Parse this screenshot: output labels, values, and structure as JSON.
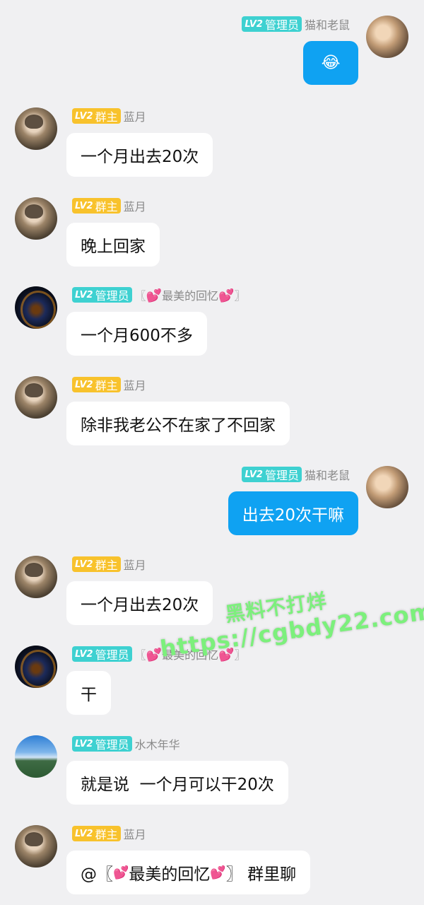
{
  "messages": [
    {
      "side": "out",
      "role": "管理员",
      "name": "猫和老鼠",
      "content": "😂",
      "avatar": "cat-avatar"
    },
    {
      "side": "in",
      "role": "群主",
      "name": "蓝月",
      "content": "一个月出去20次",
      "avatar": "user-avatar"
    },
    {
      "side": "in",
      "role": "群主",
      "name": "蓝月",
      "content": "晚上回家",
      "avatar": "user-avatar"
    },
    {
      "side": "in",
      "role": "管理员",
      "name_parts": [
        "〖",
        "💕",
        "最美的回忆",
        "💕",
        "〗"
      ],
      "content": "一个月600不多",
      "avatar": "dark-avatar"
    },
    {
      "side": "in",
      "role": "群主",
      "name": "蓝月",
      "content": "除非我老公不在家了不回家",
      "avatar": "user-avatar"
    },
    {
      "side": "out",
      "role": "管理员",
      "name": "猫和老鼠",
      "content": "出去20次干嘛",
      "avatar": "cat-avatar"
    },
    {
      "side": "in",
      "role": "群主",
      "name": "蓝月",
      "content": "一个月出去20次",
      "avatar": "user-avatar"
    },
    {
      "side": "in",
      "role": "管理员",
      "name_parts": [
        "〖",
        "💕",
        "最美的回忆",
        "💕",
        "〗"
      ],
      "content": "干",
      "avatar": "dark-avatar"
    },
    {
      "side": "in",
      "role": "管理员",
      "name": "水木年华",
      "content": "就是说  一个月可以干20次",
      "avatar": "sky-avatar"
    },
    {
      "side": "in",
      "role": "群主",
      "name": "蓝月",
      "content_parts": [
        "@〖",
        "💕",
        "最美的回忆",
        "💕",
        "〗 群里聊"
      ],
      "avatar": "user-avatar"
    }
  ],
  "badges": {
    "lv": "LV2",
    "admin": "管理员",
    "owner": "群主"
  },
  "watermark": {
    "line1": "黑料不打烊",
    "line2": "https://cgbdy22.com"
  },
  "colors": {
    "out_bubble": "#0fa2f2",
    "in_bubble": "#ffffff",
    "admin_badge": "#3ed1d1",
    "owner_badge": "#f8c22c",
    "background": "#f0f0f2"
  }
}
